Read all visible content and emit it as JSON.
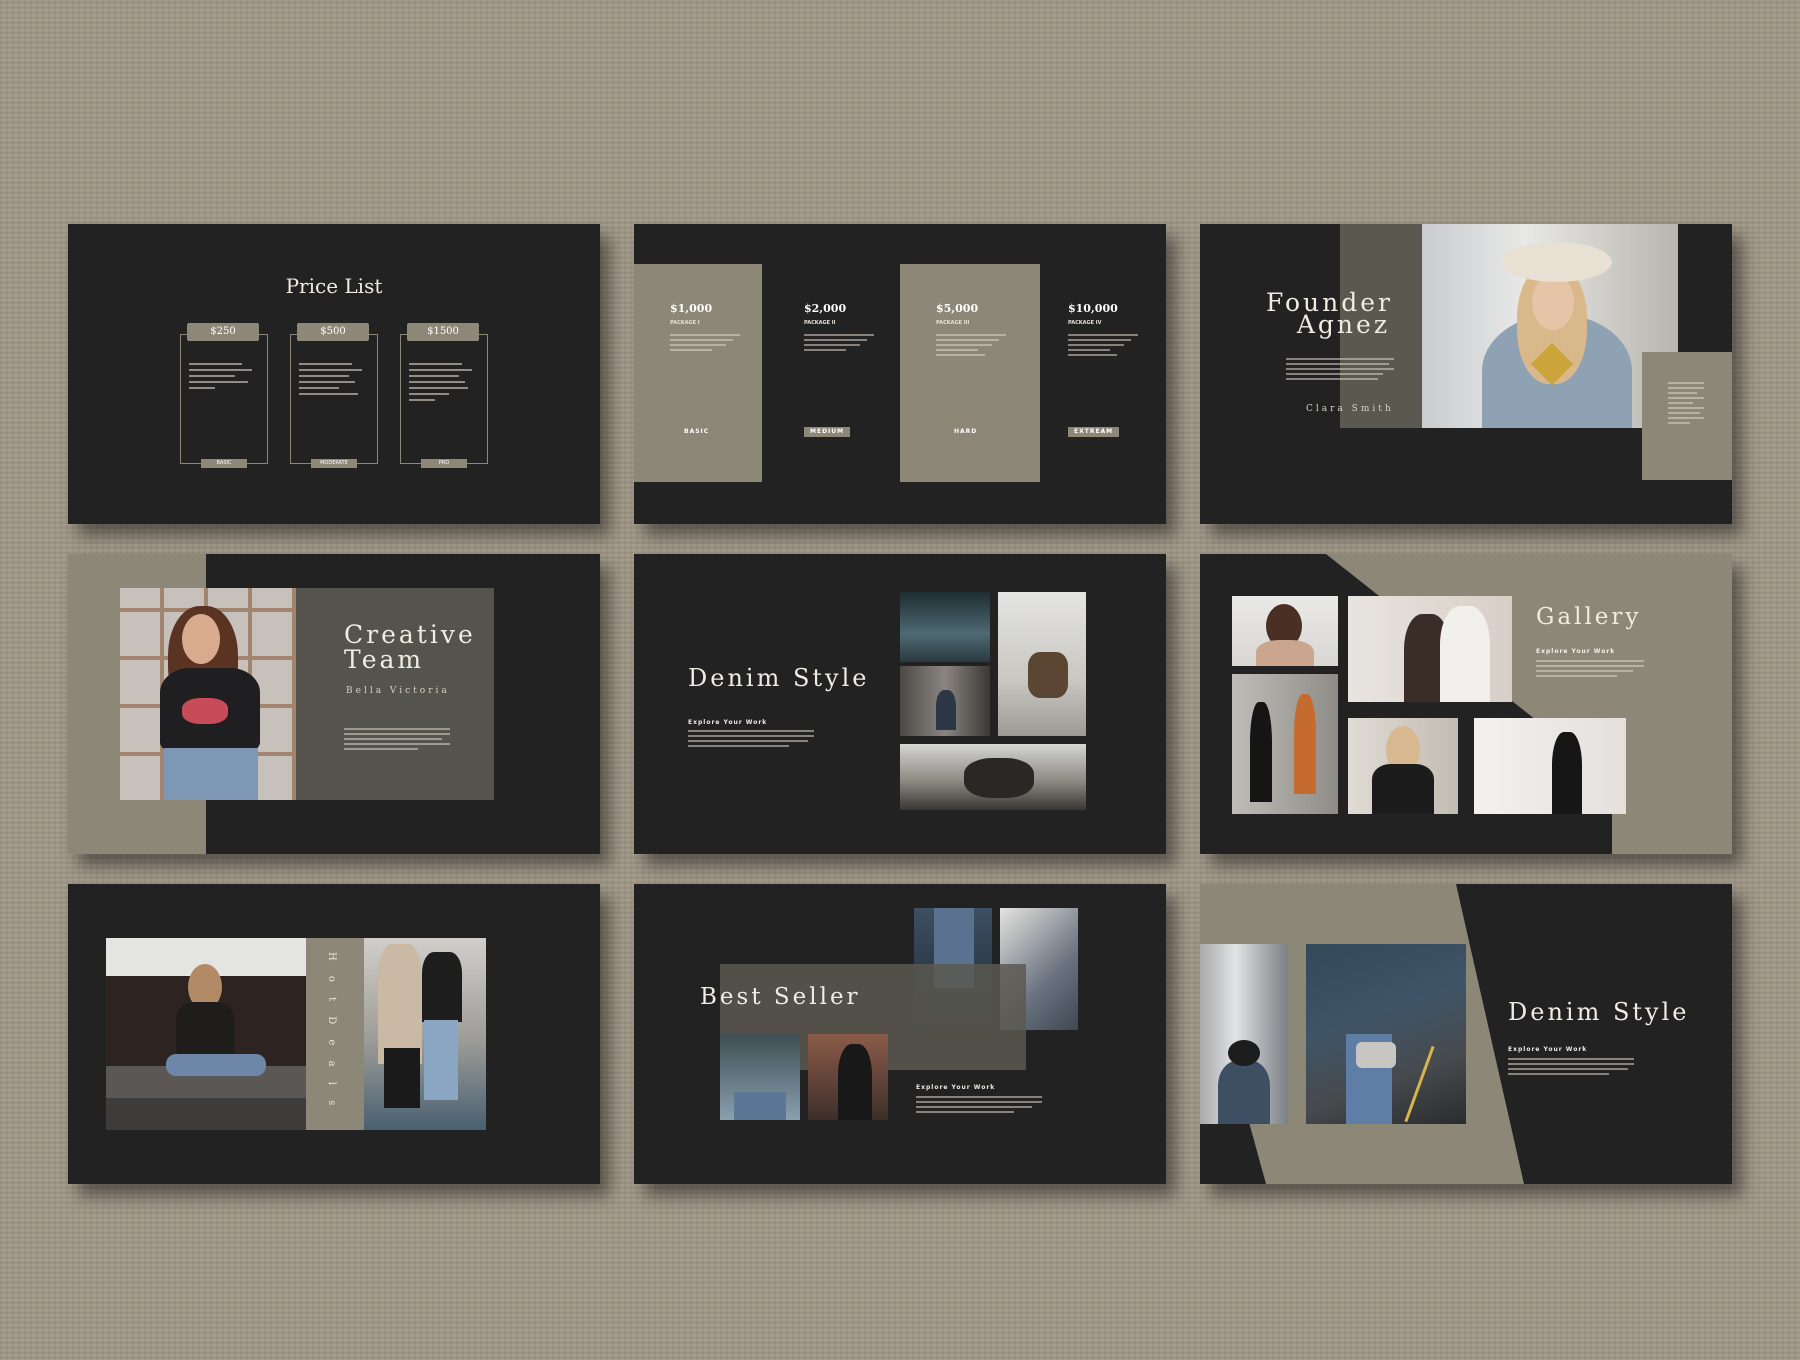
{
  "price_list": {
    "title": "Price List",
    "cards": [
      {
        "price": "$250",
        "label": "BASIC"
      },
      {
        "price": "$500",
        "label": "MODERATE"
      },
      {
        "price": "$1500",
        "label": "PRO"
      }
    ]
  },
  "packages": [
    {
      "amount": "$1,000",
      "name": "PACKAGE I",
      "level": "BASIC"
    },
    {
      "amount": "$2,000",
      "name": "PACKAGE II",
      "level": "MEDIUM"
    },
    {
      "amount": "$5,000",
      "name": "PACKAGE III",
      "level": "HARD"
    },
    {
      "amount": "$10,000",
      "name": "PACKAGE IV",
      "level": "EXTREAM"
    }
  ],
  "founder": {
    "title_line1": "Founder",
    "title_line2": "Agnez",
    "name": "Clara Smith"
  },
  "creative": {
    "title_line1": "Creative",
    "title_line2": "Team",
    "name": "Bella Victoria"
  },
  "denim1": {
    "title": "Denim Style",
    "subtitle": "Explore Your Work"
  },
  "gallery": {
    "title": "Gallery",
    "subtitle": "Explore Your Work"
  },
  "hot_deals": {
    "label": "H o t D e a l s"
  },
  "best_seller": {
    "title": "Best Seller",
    "subtitle": "Explore Your Work"
  },
  "denim2": {
    "title": "Denim Style",
    "subtitle": "Explore Your Work"
  },
  "colors": {
    "background": "#a39a8a",
    "slide": "#222223",
    "accent": "#8d8777"
  }
}
